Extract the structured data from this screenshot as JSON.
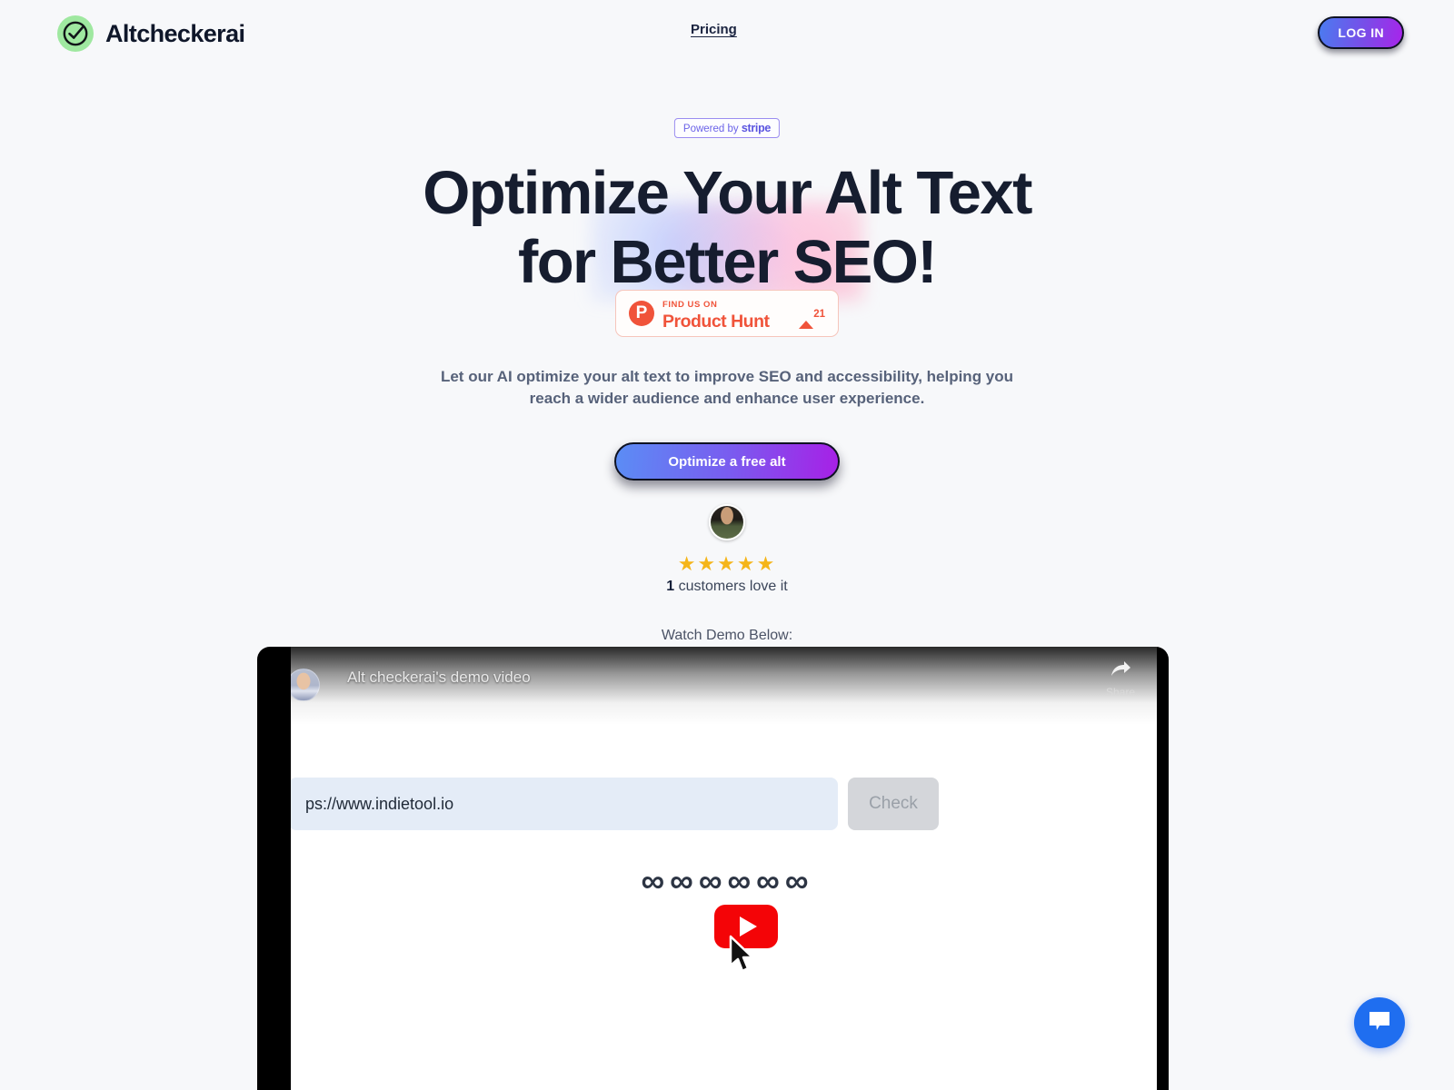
{
  "brand": {
    "name": "Altcheckerai",
    "logo_icon": "check-circle-icon"
  },
  "nav": {
    "pricing_label": "Pricing",
    "login_label": "LOG IN"
  },
  "hero": {
    "stripe_badge_prefix": "Powered by",
    "stripe_badge_brand": "stripe",
    "title_line1": "Optimize Your Alt Text",
    "title_line2_pre": "for Better ",
    "title_line2_accent": "SEO!",
    "subtitle": "Let our AI optimize your alt text to improve SEO and accessibility, helping you reach a wider audience and enhance user experience.",
    "cta_label": "Optimize a free alt",
    "stars": "★★★★★",
    "rating_count": "1",
    "rating_text": " customers love it",
    "watch_demo_label": "Watch Demo Below:"
  },
  "product_hunt": {
    "logo_letter": "P",
    "top_label": "FIND US ON",
    "main_label": "Product Hunt",
    "upvote_count": "21",
    "caret_icon": "caret-up-icon"
  },
  "video": {
    "channel_avatar": "channel-avatar",
    "title": "Alt checkerai's demo video",
    "share_label": "Share",
    "share_icon": "share-arrow-icon",
    "url_value": "ps://www.indietool.io",
    "check_button_label": "Check",
    "loader_glyphs": "∞ ∞ ∞ ∞ ∞ ∞",
    "play_icon": "youtube-play-icon",
    "cursor_icon": "mouse-cursor-icon"
  },
  "chat": {
    "icon": "chat-bubble-icon"
  },
  "colors": {
    "page_bg": "#f7f8fa",
    "heading": "#161d2f",
    "accent_gradient_start": "#5b8df5",
    "accent_gradient_end": "#a720e6",
    "product_hunt": "#f0533a",
    "stripe_purple": "#6b63e8",
    "star_yellow": "#f5b519",
    "chat_blue": "#1f6ef0",
    "youtube_red": "#f40407",
    "logo_green": "#9fe8a0"
  }
}
